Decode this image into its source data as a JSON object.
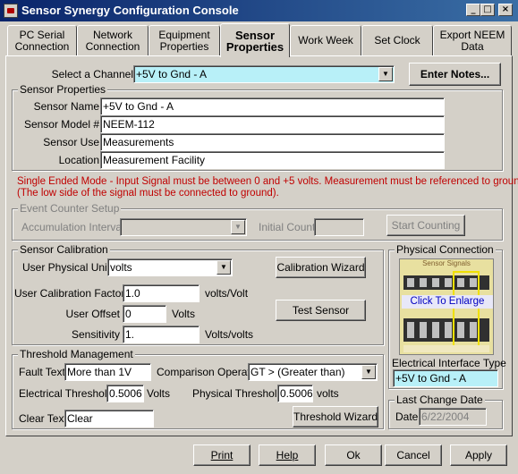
{
  "window": {
    "title": "Sensor Synergy Configuration Console",
    "controls": [
      "_",
      "□",
      "×"
    ]
  },
  "tabs": [
    {
      "label": "PC Serial Connection"
    },
    {
      "label": "Network Connection"
    },
    {
      "label": "Equipment Properties"
    },
    {
      "label": "Sensor Properties"
    },
    {
      "label": "Work Week"
    },
    {
      "label": "Set Clock"
    },
    {
      "label": "Export NEEM Data"
    }
  ],
  "channel": {
    "label": "Select a Channel",
    "value": "+5V to Gnd - A",
    "notes_button": "Enter Notes..."
  },
  "sensor_properties": {
    "title": "Sensor Properties",
    "name_label": "Sensor Name",
    "name_value": "+5V to Gnd - A",
    "model_label": "Sensor Model #",
    "model_value": "NEEM-112",
    "use_label": "Sensor Use",
    "use_value": "Measurements",
    "location_label": "Location",
    "location_value": "Measurement Facility"
  },
  "mode_message": {
    "line1": "Single Ended Mode - Input Signal must be between 0 and +5 volts. Measurement must be referenced to ground.",
    "line2": "(The low side of the signal must be connected to ground)."
  },
  "event_counter": {
    "title": "Event Counter Setup",
    "interval_label": "Accumulation Interval",
    "interval_value": "",
    "initial_label": "Initial Count",
    "initial_value": "",
    "start_button": "Start Counting"
  },
  "calibration": {
    "title": "Sensor Calibration",
    "units_label": "User Physical Units",
    "units_value": "volts",
    "wizard_button": "Calibration Wizard",
    "factor_label": "User Calibration Factor",
    "factor_value": "1.0",
    "factor_unit": "volts/Volt",
    "offset_label": "User Offset",
    "offset_value": "0",
    "offset_unit": "Volts",
    "test_button": "Test Sensor",
    "sensitivity_label": "Sensitivity",
    "sensitivity_value": "1.",
    "sensitivity_unit": "Volts/volts"
  },
  "physical_connection": {
    "title": "Physical Connection",
    "image_header": "Sensor Signals",
    "enlarge_text": "Click To Enlarge",
    "interface_label": "Electrical Interface Type",
    "interface_value": "+5V to Gnd - A"
  },
  "threshold": {
    "title": "Threshold Management",
    "fault_label": "Fault Text",
    "fault_value": "More than 1V",
    "comparison_label": "Comparison Operator",
    "comparison_value": "GT > (Greater than)",
    "elec_label": "Electrical Threshold",
    "elec_value": "0.5006",
    "elec_unit": "Volts",
    "phys_label": "Physical Threshold",
    "phys_value": "0.5006",
    "phys_unit": "volts",
    "clear_label": "Clear Text",
    "clear_value": "Clear",
    "wizard_button": "Threshold Wizard"
  },
  "last_change": {
    "title": "Last Change Date",
    "date_label": "Date",
    "date_value": "6/22/2004"
  },
  "footer": {
    "print": "Print",
    "help": "Help",
    "ok": "Ok",
    "cancel": "Cancel",
    "apply": "Apply"
  },
  "colors": {
    "title_bar": "#0a246a",
    "highlight_field": "#b8f0f8",
    "error_text": "#c00000",
    "face": "#d4d0c8"
  }
}
